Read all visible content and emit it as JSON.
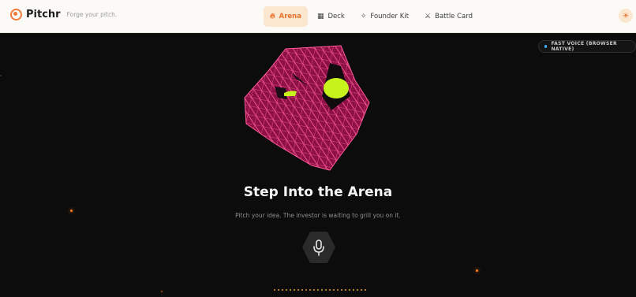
{
  "brand": {
    "name": "Pitchr",
    "tagline": "Forge your pitch.",
    "icon": "target-icon"
  },
  "nav": [
    {
      "label": "Arena",
      "icon": "flame-icon",
      "active": true
    },
    {
      "label": "Deck",
      "icon": "grid-icon",
      "active": false
    },
    {
      "label": "Founder Kit",
      "icon": "sparkle-icon",
      "active": false
    },
    {
      "label": "Battle Card",
      "icon": "crossed-swords-icon",
      "active": false
    }
  ],
  "theme_toggle": {
    "icon": "sun-icon"
  },
  "voice_badge": {
    "label": "FAST VOICE (BROWSER NATIVE)",
    "dot_color": "#3ab0ff"
  },
  "hero": {
    "title": "Step Into the Arena",
    "subtitle": "Pitch your idea. The investor is waiting to grill you on it."
  },
  "mic": {
    "icon": "microphone-icon"
  },
  "colors": {
    "accent": "#e8722a",
    "orb_mesh": "#c01f63",
    "orb_eyes": "#c8f21c",
    "background": "#0c0c0c"
  }
}
